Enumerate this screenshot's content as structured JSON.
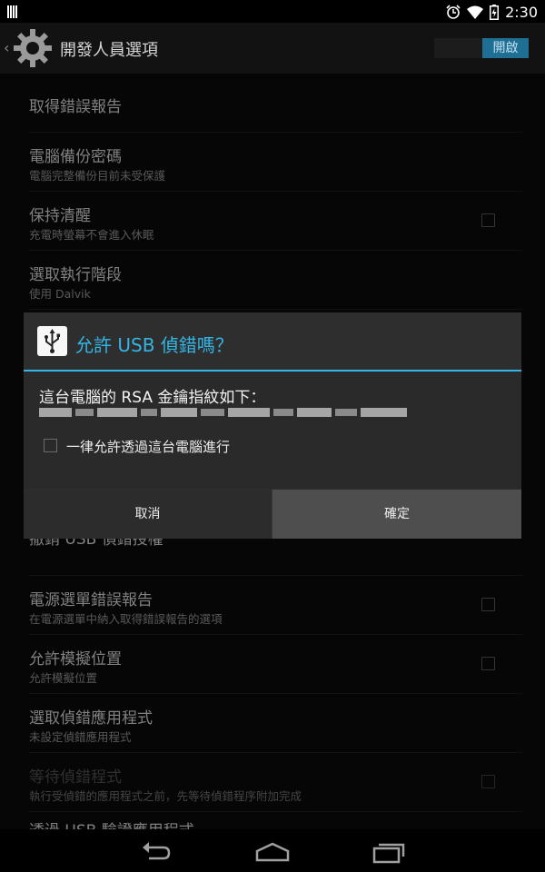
{
  "status": {
    "time": "2:30"
  },
  "action_bar": {
    "title": "開發人員選項",
    "switch_label": "開啟"
  },
  "settings": [
    {
      "title": "取得錯誤報告",
      "subtitle": "",
      "has_checkbox": false
    },
    {
      "title": "電腦備份密碼",
      "subtitle": "電腦完整備份目前未受保護",
      "has_checkbox": false
    },
    {
      "title": "保持清醒",
      "subtitle": "充電時螢幕不會進入休眠",
      "has_checkbox": true
    },
    {
      "title": "選取執行階段",
      "subtitle": "使用 Dalvik",
      "has_checkbox": false
    },
    {
      "title": "撤銷 USB 偵錯授權",
      "subtitle": "",
      "has_checkbox": false
    },
    {
      "title": "電源選單錯誤報告",
      "subtitle": "在電源選單中納入取得錯誤報告的選項",
      "has_checkbox": true
    },
    {
      "title": "允許模擬位置",
      "subtitle": "允許模擬位置",
      "has_checkbox": true
    },
    {
      "title": "選取偵錯應用程式",
      "subtitle": "未設定偵錯應用程式",
      "has_checkbox": false
    },
    {
      "title": "等待偵錯程式",
      "subtitle": "執行受偵錯的應用程式之前，先等待偵錯程序附加完成",
      "has_checkbox": true
    },
    {
      "title": "透過 USB 驗證應用程式",
      "subtitle": "",
      "has_checkbox": false
    }
  ],
  "dialog": {
    "title": "允許 USB 偵錯嗎？",
    "message": "這台電腦的 RSA 金鑰指紋如下：",
    "checkbox_label": "一律允許透過這台電腦進行",
    "checkbox_checked": false,
    "cancel_label": "取消",
    "ok_label": "確定"
  },
  "colors": {
    "accent": "#33b5e5",
    "switch_on": "#1f6e94"
  },
  "icons": {
    "action_bar": "settings-gear-icon",
    "dialog": "usb-icon",
    "nav": [
      "back-icon",
      "home-icon",
      "recent-apps-icon"
    ],
    "status": [
      "alarm-icon",
      "wifi-icon",
      "battery-icon"
    ]
  }
}
